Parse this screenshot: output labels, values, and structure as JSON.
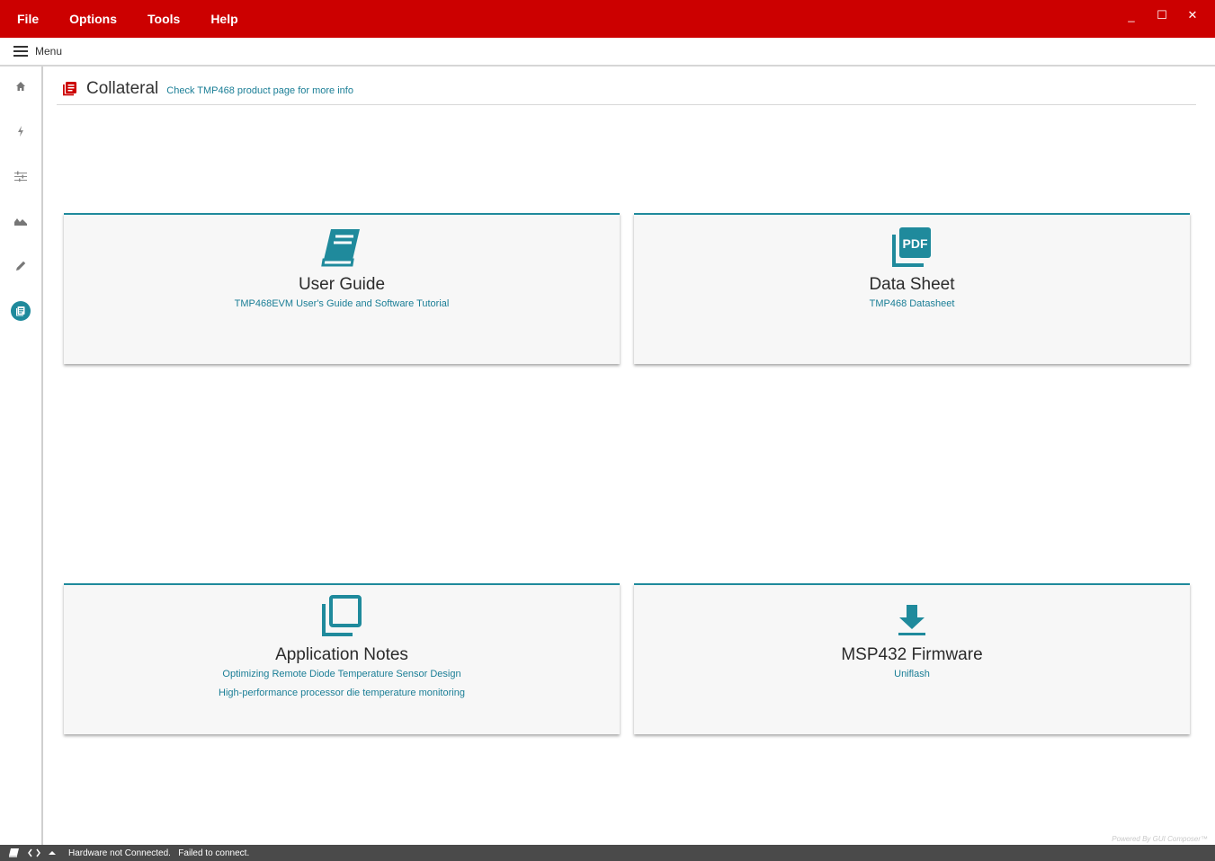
{
  "menubar": {
    "items": [
      "File",
      "Options",
      "Tools",
      "Help"
    ],
    "window_controls": {
      "minimize": "_",
      "maximize": "☐",
      "close": "✕"
    }
  },
  "toolbar": {
    "menu_label": "Menu",
    "menu_icon": "hamburger-icon"
  },
  "rail": {
    "items": [
      {
        "icon": "home-icon"
      },
      {
        "icon": "lightning-icon"
      },
      {
        "icon": "sliders-icon"
      },
      {
        "icon": "chart-area-icon"
      },
      {
        "icon": "pencil-icon"
      },
      {
        "icon": "collateral-icon",
        "active": true
      }
    ]
  },
  "header": {
    "title": "Collateral",
    "link": "Check TMP468 product page for more info",
    "icon": "collateral-icon"
  },
  "cards": [
    {
      "icon": "book-icon",
      "title": "User Guide",
      "links": [
        "TMP468EVM User's Guide and Software Tutorial"
      ]
    },
    {
      "icon": "pdf-icon",
      "title": "Data Sheet",
      "links": [
        "TMP468 Datasheet"
      ]
    },
    {
      "icon": "library-icon",
      "title": "Application Notes",
      "links": [
        "Optimizing Remote Diode Temperature Sensor Design",
        "High-performance processor die temperature monitoring"
      ]
    },
    {
      "icon": "download-icon",
      "title": "MSP432 Firmware",
      "links": [
        "Uniflash"
      ]
    }
  ],
  "statusbar": {
    "text": "Hardware not Connected.   Failed to connect.",
    "powered_by": "Powered By GUI Composer™"
  },
  "colors": {
    "brand": "#cc0000",
    "accent": "#1f8a9c",
    "status_bg": "#4a4a4a"
  }
}
